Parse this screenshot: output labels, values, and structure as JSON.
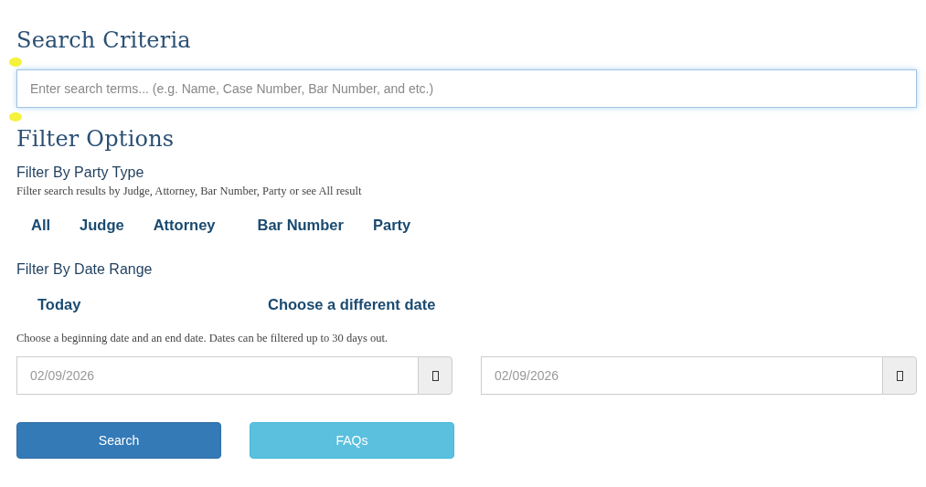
{
  "search_criteria": {
    "title": "Search Criteria",
    "search": {
      "placeholder": "Enter search terms... (e.g. Name, Case Number, Bar Number, and etc.)"
    }
  },
  "filter_options": {
    "title": "Filter Options",
    "party_type": {
      "label": "Filter By Party Type",
      "hint": "Filter search results by Judge, Attorney, Bar Number, Party or see All result",
      "options": [
        "All",
        "Judge",
        "Attorney",
        "Bar Number",
        "Party"
      ]
    },
    "date_range": {
      "label": "Filter By Date Range",
      "options": [
        "Today",
        "Choose a different date"
      ],
      "hint": "Choose a beginning date and an end date. Dates can be filtered up to 30 days out.",
      "fields": [
        {
          "placeholder": "02/09/2026"
        },
        {
          "placeholder": "02/09/2026"
        }
      ]
    }
  },
  "buttons": [
    {
      "label": "Search",
      "kind": "primary"
    },
    {
      "label": "FAQs",
      "kind": "info"
    }
  ]
}
